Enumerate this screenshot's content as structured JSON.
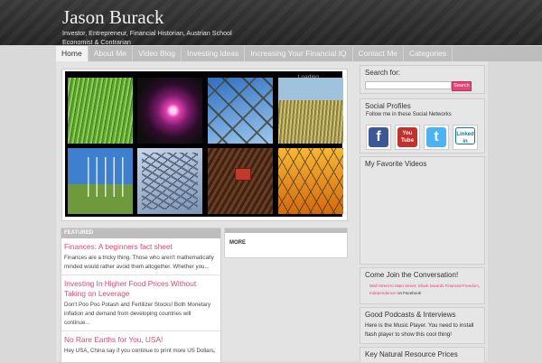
{
  "site": {
    "title": "Jason Burack",
    "tagline": "Investor, Entrepreneur, Financial Historian, Austrian School Economist & Contrarian"
  },
  "nav": {
    "items": [
      {
        "label": "Home"
      },
      {
        "label": "About Me"
      },
      {
        "label": "Video Blog"
      },
      {
        "label": "Investing Ideas"
      },
      {
        "label": "Increasing Your Financial IQ"
      },
      {
        "label": "Contact Me"
      },
      {
        "label": "Categories"
      }
    ]
  },
  "slider": {
    "loading_text": "Loading"
  },
  "featured": {
    "heading": "FEATURED",
    "posts": [
      {
        "title": "Finances: A beginners fact sheet",
        "excerpt": "Finances are a tricky thing. Those who aren't mathematically minded would rather avoid them altogether. Whether you..."
      },
      {
        "title": "Investing In Higher Food Prices Without Taking on Leverage",
        "excerpt": "Don't Poo Poo Potash and Fertilizer Stocks! Both Monetary inflation and demand from developing countries will continue..."
      },
      {
        "title": "No Rare Earths for You, USA!",
        "excerpt": "Hey USA, China say if you continue to print more US Dollars,"
      }
    ]
  },
  "more_box": {
    "label": "MORE"
  },
  "sidebar": {
    "search": {
      "title": "Search for:",
      "placeholder": "",
      "button": "Search"
    },
    "social": {
      "title": "Social Profiles",
      "desc": "Follow me in these Social Networks",
      "icons": [
        {
          "name": "facebook-icon",
          "glyph": "f",
          "color": "#3b5998"
        },
        {
          "name": "youtube-icon",
          "glyph": "You Tube",
          "color": "#c4302b"
        },
        {
          "name": "twitter-icon",
          "glyph": "t",
          "color": "#4ab3f4"
        },
        {
          "name": "linkedin-icon",
          "glyph": "Linked in",
          "color": "#0e76a8"
        }
      ]
    },
    "videos": {
      "title": "My Favorite Videos"
    },
    "conversation": {
      "title": "Come Join the Conversation!",
      "line1": "Wall Street to Main Street: Shark towards Financial Freedom,",
      "line2": "Independence!",
      "line2_link": "on Facebook"
    },
    "podcasts": {
      "title": "Good Podcasts & Interviews",
      "text": "Here is the Music Player. You need to install flash player to show this cool thing!"
    },
    "prices": {
      "title": "Key Natural Resource Prices"
    }
  }
}
